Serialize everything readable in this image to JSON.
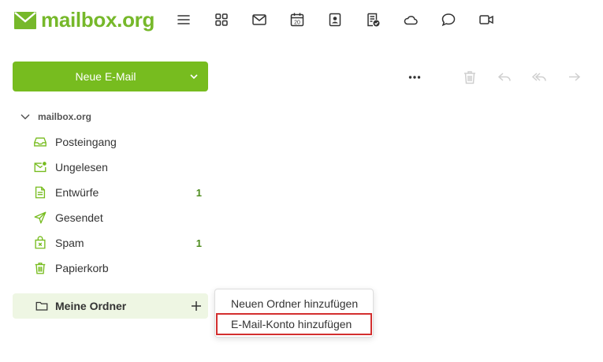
{
  "brand": {
    "name": "mailbox.org",
    "color": "#76b82a"
  },
  "apps": [
    {
      "icon": "menu-icon"
    },
    {
      "icon": "apps-grid-icon"
    },
    {
      "icon": "mail-icon"
    },
    {
      "icon": "calendar-icon",
      "day": "20"
    },
    {
      "icon": "contacts-icon"
    },
    {
      "icon": "tasks-icon"
    },
    {
      "icon": "cloud-icon"
    },
    {
      "icon": "chat-icon"
    },
    {
      "icon": "video-icon"
    }
  ],
  "compose": {
    "label": "Neue E-Mail",
    "color": "#77bc1f"
  },
  "toolbar": [
    "more-icon",
    "trash-icon",
    "reply-icon",
    "reply-all-icon",
    "forward-icon"
  ],
  "account": {
    "name": "mailbox.org"
  },
  "folders": [
    {
      "label": "Posteingang",
      "icon": "inbox-icon",
      "count": ""
    },
    {
      "label": "Ungelesen",
      "icon": "unread-icon",
      "count": ""
    },
    {
      "label": "Entwürfe",
      "icon": "drafts-icon",
      "count": "1"
    },
    {
      "label": "Gesendet",
      "icon": "sent-icon",
      "count": ""
    },
    {
      "label": "Spam",
      "icon": "spam-icon",
      "count": "1"
    },
    {
      "label": "Papierkorb",
      "icon": "trash-icon",
      "count": ""
    }
  ],
  "my_folders": {
    "label": "Meine Ordner"
  },
  "context_menu": {
    "items": [
      {
        "label": "Neuen Ordner hinzufügen"
      },
      {
        "label": "E-Mail-Konto hinzufügen"
      }
    ]
  }
}
